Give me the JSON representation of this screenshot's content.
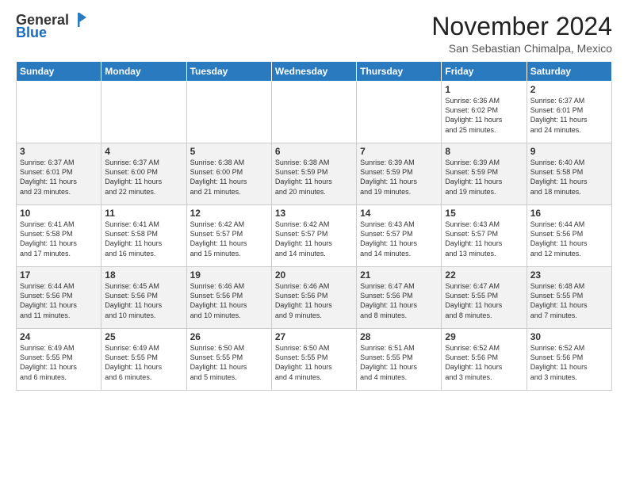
{
  "header": {
    "logo_general": "General",
    "logo_blue": "Blue",
    "month_title": "November 2024",
    "location": "San Sebastian Chimalpa, Mexico"
  },
  "days_of_week": [
    "Sunday",
    "Monday",
    "Tuesday",
    "Wednesday",
    "Thursday",
    "Friday",
    "Saturday"
  ],
  "weeks": [
    [
      {
        "day": "",
        "info": ""
      },
      {
        "day": "",
        "info": ""
      },
      {
        "day": "",
        "info": ""
      },
      {
        "day": "",
        "info": ""
      },
      {
        "day": "",
        "info": ""
      },
      {
        "day": "1",
        "info": "Sunrise: 6:36 AM\nSunset: 6:02 PM\nDaylight: 11 hours\nand 25 minutes."
      },
      {
        "day": "2",
        "info": "Sunrise: 6:37 AM\nSunset: 6:01 PM\nDaylight: 11 hours\nand 24 minutes."
      }
    ],
    [
      {
        "day": "3",
        "info": "Sunrise: 6:37 AM\nSunset: 6:01 PM\nDaylight: 11 hours\nand 23 minutes."
      },
      {
        "day": "4",
        "info": "Sunrise: 6:37 AM\nSunset: 6:00 PM\nDaylight: 11 hours\nand 22 minutes."
      },
      {
        "day": "5",
        "info": "Sunrise: 6:38 AM\nSunset: 6:00 PM\nDaylight: 11 hours\nand 21 minutes."
      },
      {
        "day": "6",
        "info": "Sunrise: 6:38 AM\nSunset: 5:59 PM\nDaylight: 11 hours\nand 20 minutes."
      },
      {
        "day": "7",
        "info": "Sunrise: 6:39 AM\nSunset: 5:59 PM\nDaylight: 11 hours\nand 19 minutes."
      },
      {
        "day": "8",
        "info": "Sunrise: 6:39 AM\nSunset: 5:59 PM\nDaylight: 11 hours\nand 19 minutes."
      },
      {
        "day": "9",
        "info": "Sunrise: 6:40 AM\nSunset: 5:58 PM\nDaylight: 11 hours\nand 18 minutes."
      }
    ],
    [
      {
        "day": "10",
        "info": "Sunrise: 6:41 AM\nSunset: 5:58 PM\nDaylight: 11 hours\nand 17 minutes."
      },
      {
        "day": "11",
        "info": "Sunrise: 6:41 AM\nSunset: 5:58 PM\nDaylight: 11 hours\nand 16 minutes."
      },
      {
        "day": "12",
        "info": "Sunrise: 6:42 AM\nSunset: 5:57 PM\nDaylight: 11 hours\nand 15 minutes."
      },
      {
        "day": "13",
        "info": "Sunrise: 6:42 AM\nSunset: 5:57 PM\nDaylight: 11 hours\nand 14 minutes."
      },
      {
        "day": "14",
        "info": "Sunrise: 6:43 AM\nSunset: 5:57 PM\nDaylight: 11 hours\nand 14 minutes."
      },
      {
        "day": "15",
        "info": "Sunrise: 6:43 AM\nSunset: 5:57 PM\nDaylight: 11 hours\nand 13 minutes."
      },
      {
        "day": "16",
        "info": "Sunrise: 6:44 AM\nSunset: 5:56 PM\nDaylight: 11 hours\nand 12 minutes."
      }
    ],
    [
      {
        "day": "17",
        "info": "Sunrise: 6:44 AM\nSunset: 5:56 PM\nDaylight: 11 hours\nand 11 minutes."
      },
      {
        "day": "18",
        "info": "Sunrise: 6:45 AM\nSunset: 5:56 PM\nDaylight: 11 hours\nand 10 minutes."
      },
      {
        "day": "19",
        "info": "Sunrise: 6:46 AM\nSunset: 5:56 PM\nDaylight: 11 hours\nand 10 minutes."
      },
      {
        "day": "20",
        "info": "Sunrise: 6:46 AM\nSunset: 5:56 PM\nDaylight: 11 hours\nand 9 minutes."
      },
      {
        "day": "21",
        "info": "Sunrise: 6:47 AM\nSunset: 5:56 PM\nDaylight: 11 hours\nand 8 minutes."
      },
      {
        "day": "22",
        "info": "Sunrise: 6:47 AM\nSunset: 5:55 PM\nDaylight: 11 hours\nand 8 minutes."
      },
      {
        "day": "23",
        "info": "Sunrise: 6:48 AM\nSunset: 5:55 PM\nDaylight: 11 hours\nand 7 minutes."
      }
    ],
    [
      {
        "day": "24",
        "info": "Sunrise: 6:49 AM\nSunset: 5:55 PM\nDaylight: 11 hours\nand 6 minutes."
      },
      {
        "day": "25",
        "info": "Sunrise: 6:49 AM\nSunset: 5:55 PM\nDaylight: 11 hours\nand 6 minutes."
      },
      {
        "day": "26",
        "info": "Sunrise: 6:50 AM\nSunset: 5:55 PM\nDaylight: 11 hours\nand 5 minutes."
      },
      {
        "day": "27",
        "info": "Sunrise: 6:50 AM\nSunset: 5:55 PM\nDaylight: 11 hours\nand 4 minutes."
      },
      {
        "day": "28",
        "info": "Sunrise: 6:51 AM\nSunset: 5:55 PM\nDaylight: 11 hours\nand 4 minutes."
      },
      {
        "day": "29",
        "info": "Sunrise: 6:52 AM\nSunset: 5:56 PM\nDaylight: 11 hours\nand 3 minutes."
      },
      {
        "day": "30",
        "info": "Sunrise: 6:52 AM\nSunset: 5:56 PM\nDaylight: 11 hours\nand 3 minutes."
      }
    ]
  ]
}
